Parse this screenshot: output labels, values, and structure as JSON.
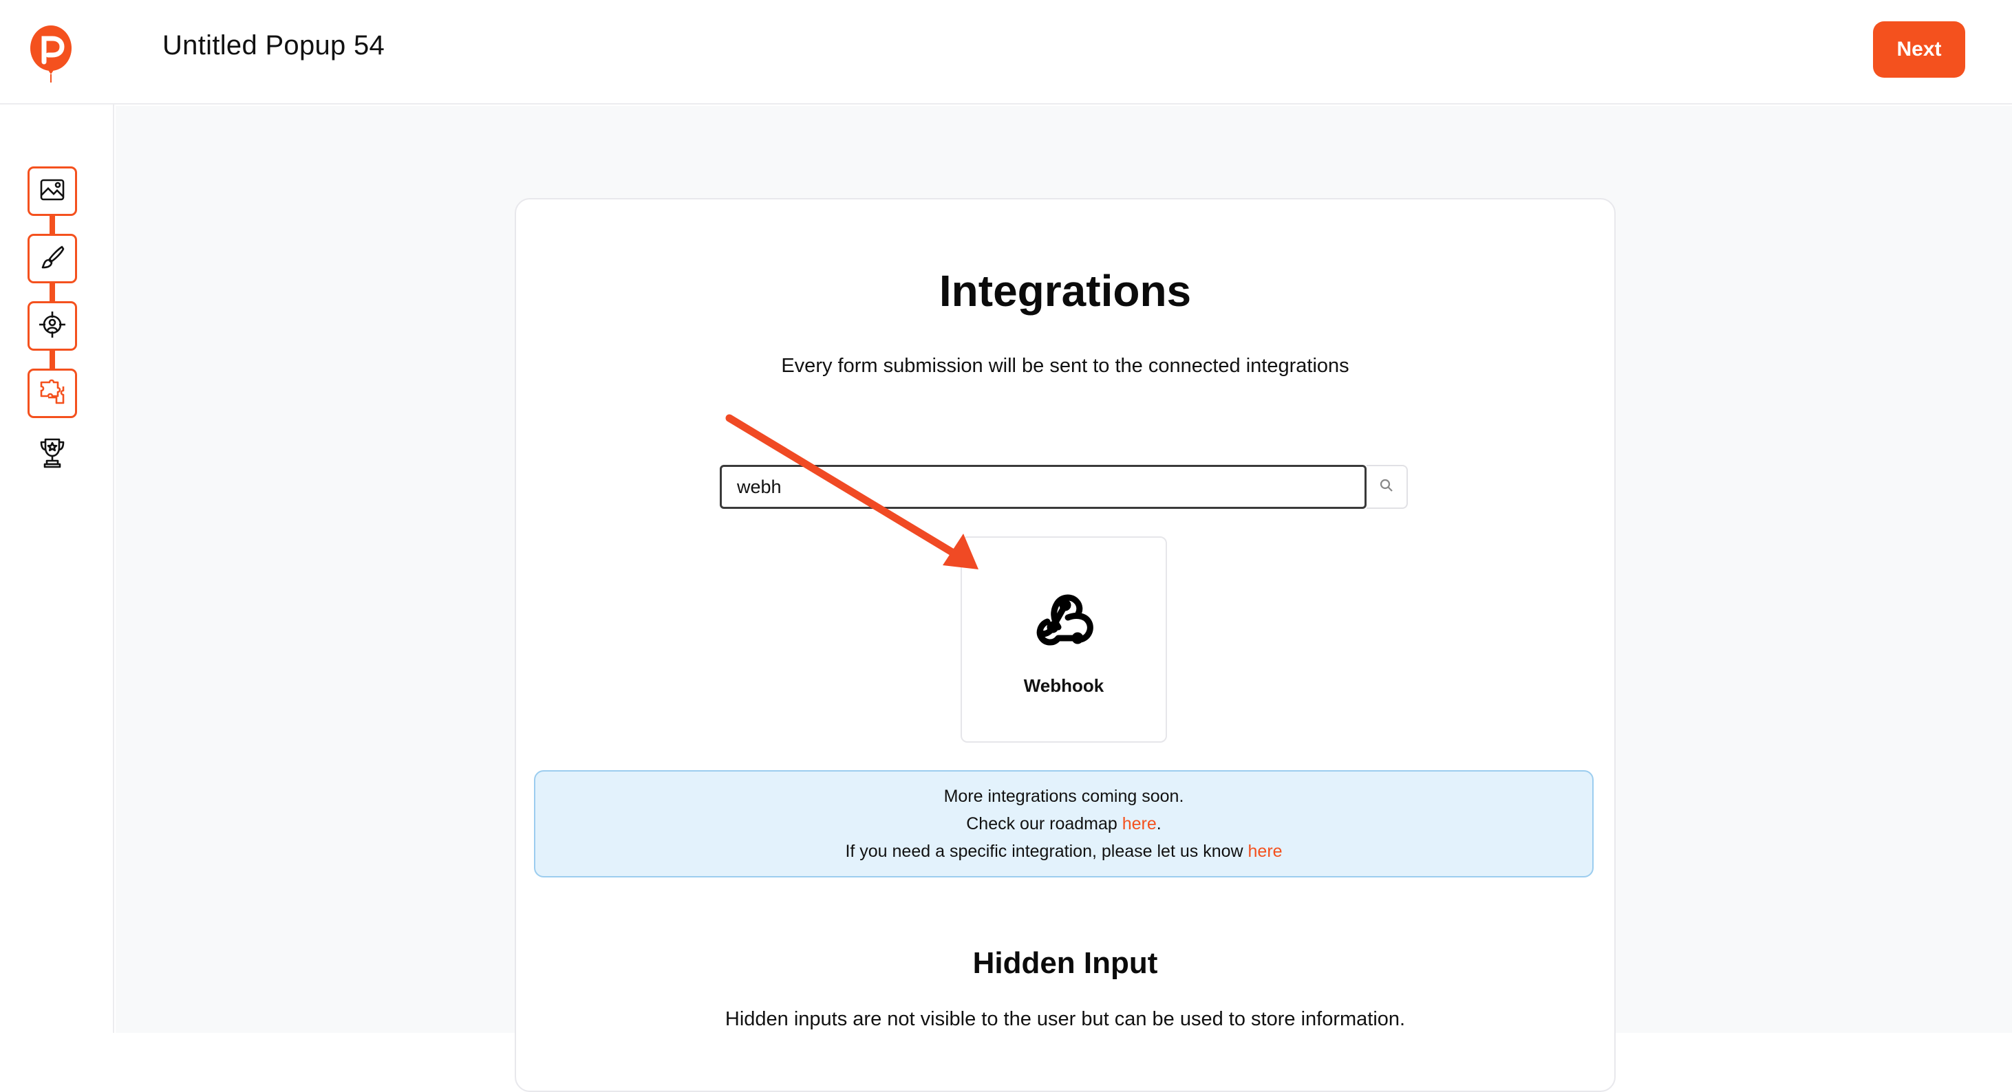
{
  "header": {
    "logo_icon": "balloon-logo-icon",
    "title": "Untitled Popup 54",
    "next_label": "Next"
  },
  "sidebar": {
    "steps": [
      {
        "icon": "image-icon"
      },
      {
        "icon": "brush-icon"
      },
      {
        "icon": "target-icon"
      },
      {
        "icon": "puzzle-icon"
      }
    ],
    "trophy_icon": "trophy-icon"
  },
  "integrations": {
    "title": "Integrations",
    "subtitle": "Every form submission will be sent to the connected integrations",
    "search": {
      "value": "webh",
      "icon": "search-icon"
    },
    "results": [
      {
        "name": "Webhook",
        "icon": "webhook-icon"
      }
    ],
    "notice": {
      "line1": "More integrations coming soon.",
      "line2_prefix": "Check our roadmap ",
      "line2_link": "here",
      "line2_suffix": ".",
      "line3_prefix": "If you need a specific integration, please let us know ",
      "line3_link": "here"
    }
  },
  "hidden_input": {
    "title": "Hidden Input",
    "description": "Hidden inputs are not visible to the user but can be used to store information."
  },
  "colors": {
    "accent": "#f4511e",
    "notice_bg": "#e3f2fc",
    "notice_border": "#9ccdef",
    "main_bg": "#f8f9fa"
  }
}
